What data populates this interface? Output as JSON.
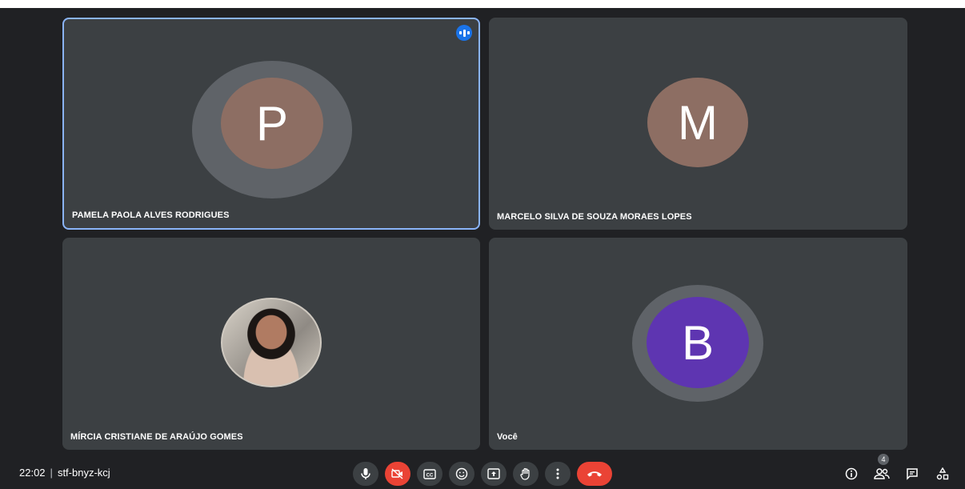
{
  "participants": [
    {
      "name": "PAMELA PAOLA ALVES RODRIGUES",
      "initial": "P",
      "color": "#8d6e63",
      "speaking": true
    },
    {
      "name": "MARCELO SILVA DE SOUZA MORAES LOPES",
      "initial": "M",
      "color": "#8d6e63",
      "speaking": false
    },
    {
      "name": "MÍRCIA CRISTIANE DE ARAÚJO GOMES",
      "initial": "",
      "photo": true,
      "speaking": false
    },
    {
      "name": "Você",
      "initial": "B",
      "color": "#5e35b1",
      "speaking": false
    }
  ],
  "footer": {
    "time": "22:02",
    "separator": "|",
    "meeting_code": "stf-bnyz-kcj",
    "people_count": "4"
  },
  "controls": [
    {
      "id": "mic",
      "icon": "mic-icon"
    },
    {
      "id": "camera",
      "icon": "camera-off-icon",
      "state": "off"
    },
    {
      "id": "captions",
      "icon": "captions-icon"
    },
    {
      "id": "reactions",
      "icon": "emoji-icon"
    },
    {
      "id": "present",
      "icon": "present-icon"
    },
    {
      "id": "raise-hand",
      "icon": "hand-icon"
    },
    {
      "id": "more",
      "icon": "more-vert-icon"
    },
    {
      "id": "leave",
      "icon": "hangup-icon"
    }
  ],
  "colors": {
    "background": "#202124",
    "tile": "#3c4043",
    "active_border": "#8ab4f8",
    "danger": "#ea4335",
    "accent": "#1a73e8"
  }
}
